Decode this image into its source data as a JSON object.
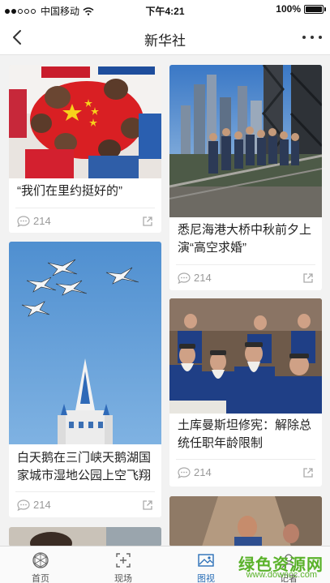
{
  "status": {
    "carrier": "中国移动",
    "time": "下午4:21",
    "battery": "100%",
    "battery_level": 1.0
  },
  "nav": {
    "title": "新华社",
    "back_icon": "chevron-left-icon",
    "more_icon": "more-dots-icon"
  },
  "cards": [
    {
      "title": "“我们在里约挺好的”",
      "comments": "214"
    },
    {
      "title": "悉尼海港大桥中秋前夕上演“高空求婚”",
      "comments": "214"
    },
    {
      "title": "白天鹅在三门峡天鹅湖国家城市湿地公园上空飞翔",
      "comments": "214"
    },
    {
      "title": "土库曼斯坦修宪：解除总统任职年龄限制",
      "comments": "214"
    }
  ],
  "tabs": [
    {
      "label": "首页",
      "icon": "globe-icon"
    },
    {
      "label": "现场",
      "icon": "live-frame-icon"
    },
    {
      "label": "图视",
      "icon": "image-icon"
    },
    {
      "label": "记者",
      "icon": "reporter-icon"
    }
  ],
  "colors": {
    "accent": "#2a6fb7",
    "watermark": "#5ab22a"
  },
  "watermark": {
    "main": "绿色资源网",
    "sub": "www.downcc.com"
  }
}
